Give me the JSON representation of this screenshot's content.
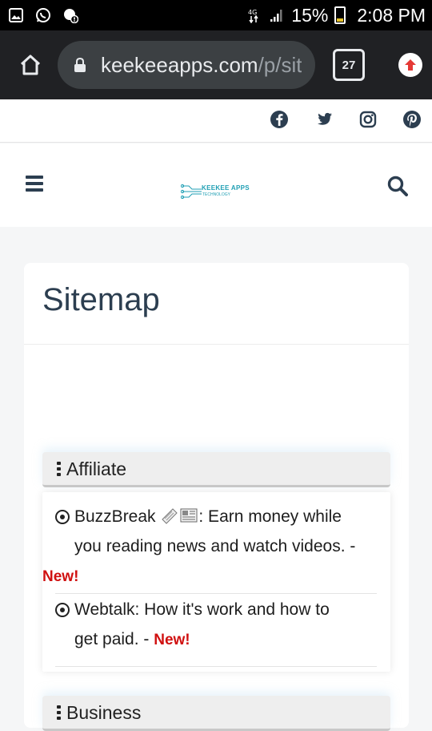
{
  "status_bar": {
    "battery": "15%",
    "time": "2:08 PM",
    "network_label": "4G"
  },
  "browser": {
    "url_main": "keekeeapps.com",
    "url_path": "/p/sit",
    "tab_count": "27"
  },
  "site": {
    "logo_text": "KEEKEE APPS",
    "logo_sub": "TECHNOLOGY",
    "page_title": "Sitemap"
  },
  "sections": {
    "affiliate": {
      "title": "Affiliate",
      "items": [
        {
          "line1": "BuzzBreak",
          "line1_rest": ": Earn money while",
          "line2": "you reading news and watch videos. -",
          "badge": "New!"
        },
        {
          "line1": "Webtalk: How it's work and how to",
          "line2": "get paid. - ",
          "badge": "New!"
        }
      ]
    },
    "business": {
      "title": "Business"
    }
  },
  "colors": {
    "title": "#2c3e50",
    "new_badge": "#d01010",
    "brand": "#1f9fb4"
  }
}
